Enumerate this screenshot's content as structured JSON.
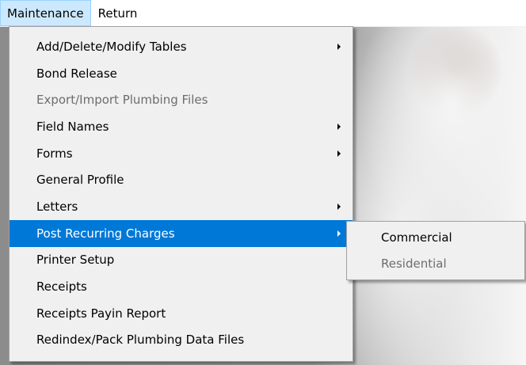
{
  "menubar": {
    "items": [
      {
        "label": "Maintenance",
        "open": true
      },
      {
        "label": "Return",
        "open": false
      }
    ]
  },
  "dropdown": {
    "items": [
      {
        "label": "Add/Delete/Modify Tables",
        "submenu": true,
        "disabled": false
      },
      {
        "label": "Bond Release",
        "submenu": false,
        "disabled": false
      },
      {
        "label": "Export/Import Plumbing Files",
        "submenu": false,
        "disabled": true
      },
      {
        "label": "Field Names",
        "submenu": true,
        "disabled": false
      },
      {
        "label": "Forms",
        "submenu": true,
        "disabled": false
      },
      {
        "label": "General Profile",
        "submenu": false,
        "disabled": false
      },
      {
        "label": "Letters",
        "submenu": true,
        "disabled": false
      },
      {
        "label": "Post Recurring Charges",
        "submenu": true,
        "disabled": false,
        "highlighted": true
      },
      {
        "label": "Printer Setup",
        "submenu": false,
        "disabled": false
      },
      {
        "label": "Receipts",
        "submenu": false,
        "disabled": false
      },
      {
        "label": "Receipts Payin Report",
        "submenu": false,
        "disabled": false
      },
      {
        "label": "Redindex/Pack Plumbing Data Files",
        "submenu": false,
        "disabled": false
      }
    ]
  },
  "submenu": {
    "items": [
      {
        "label": "Commercial",
        "disabled": false
      },
      {
        "label": "Residential",
        "disabled": true
      }
    ]
  },
  "colors": {
    "highlight": "#0078d7",
    "menu_bg": "#f0f0f0",
    "menubar_open": "#cce8ff",
    "disabled_text": "#6d6d6d"
  }
}
